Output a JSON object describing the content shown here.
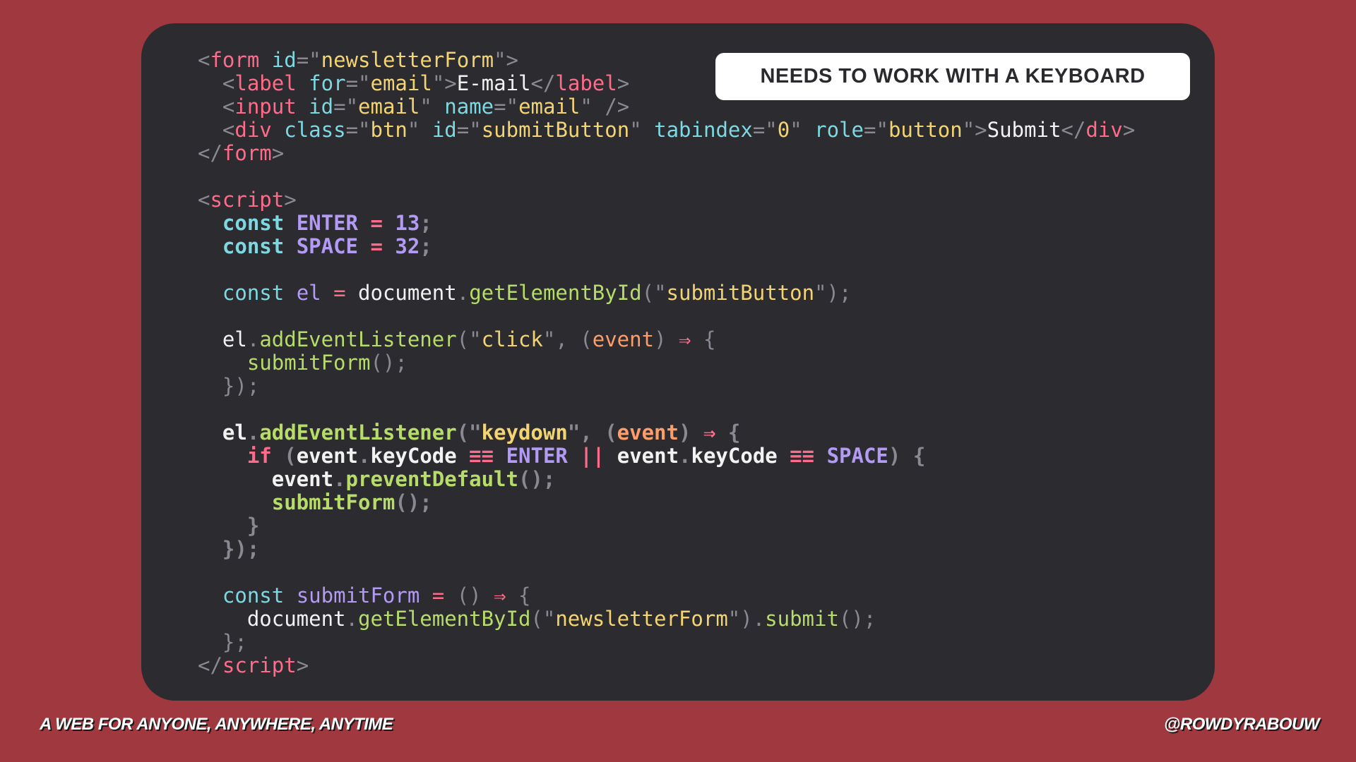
{
  "badge": "NEEDS TO WORK WITH A KEYBOARD",
  "footer": {
    "left": "A WEB FOR ANYONE, ANYWHERE, ANYTIME",
    "right": "@ROWDYRABOUW"
  },
  "colors": {
    "background": "#a03840",
    "card": "#2c2b30",
    "tag": "#ff6b8a",
    "attribute": "#7dd8e2",
    "string": "#f3d472",
    "keyword": "#7dd8e2",
    "variable": "#b39af5",
    "function": "#b8dc6a",
    "parameter": "#fc9d6a"
  },
  "code_lines": [
    {
      "bold": false,
      "tokens": [
        [
          "punct",
          "<"
        ],
        [
          "tag",
          "form"
        ],
        [
          "plain",
          " "
        ],
        [
          "attr",
          "id"
        ],
        [
          "punct",
          "="
        ],
        [
          "punct",
          "\""
        ],
        [
          "str",
          "newsletterForm"
        ],
        [
          "punct",
          "\">"
        ]
      ]
    },
    {
      "bold": false,
      "tokens": [
        [
          "plain",
          "  "
        ],
        [
          "punct",
          "<"
        ],
        [
          "tag",
          "label"
        ],
        [
          "plain",
          " "
        ],
        [
          "attr",
          "for"
        ],
        [
          "punct",
          "="
        ],
        [
          "punct",
          "\""
        ],
        [
          "str",
          "email"
        ],
        [
          "punct",
          "\">"
        ],
        [
          "plain",
          "E-mail"
        ],
        [
          "punct",
          "</"
        ],
        [
          "tag",
          "label"
        ],
        [
          "punct",
          ">"
        ]
      ]
    },
    {
      "bold": false,
      "tokens": [
        [
          "plain",
          "  "
        ],
        [
          "punct",
          "<"
        ],
        [
          "tag",
          "input"
        ],
        [
          "plain",
          " "
        ],
        [
          "attr",
          "id"
        ],
        [
          "punct",
          "="
        ],
        [
          "punct",
          "\""
        ],
        [
          "str",
          "email"
        ],
        [
          "punct",
          "\""
        ],
        [
          "plain",
          " "
        ],
        [
          "attr",
          "name"
        ],
        [
          "punct",
          "="
        ],
        [
          "punct",
          "\""
        ],
        [
          "str",
          "email"
        ],
        [
          "punct",
          "\""
        ],
        [
          "plain",
          " "
        ],
        [
          "punct",
          "/>"
        ]
      ]
    },
    {
      "bold": false,
      "tokens": [
        [
          "plain",
          "  "
        ],
        [
          "punct",
          "<"
        ],
        [
          "tag",
          "div"
        ],
        [
          "plain",
          " "
        ],
        [
          "attr",
          "class"
        ],
        [
          "punct",
          "="
        ],
        [
          "punct",
          "\""
        ],
        [
          "str",
          "btn"
        ],
        [
          "punct",
          "\""
        ],
        [
          "plain",
          " "
        ],
        [
          "attr",
          "id"
        ],
        [
          "punct",
          "="
        ],
        [
          "punct",
          "\""
        ],
        [
          "str",
          "submitButton"
        ],
        [
          "punct",
          "\""
        ],
        [
          "plain",
          " "
        ],
        [
          "attr",
          "tabindex"
        ],
        [
          "punct",
          "="
        ],
        [
          "punct",
          "\""
        ],
        [
          "str",
          "0"
        ],
        [
          "punct",
          "\""
        ],
        [
          "plain",
          " "
        ],
        [
          "attr",
          "role"
        ],
        [
          "punct",
          "="
        ],
        [
          "punct",
          "\""
        ],
        [
          "str",
          "button"
        ],
        [
          "punct",
          "\">"
        ],
        [
          "plain",
          "Submit"
        ],
        [
          "punct",
          "</"
        ],
        [
          "tag",
          "div"
        ],
        [
          "punct",
          ">"
        ]
      ]
    },
    {
      "bold": false,
      "tokens": [
        [
          "punct",
          "</"
        ],
        [
          "tag",
          "form"
        ],
        [
          "punct",
          ">"
        ]
      ]
    },
    {
      "bold": false,
      "tokens": []
    },
    {
      "bold": false,
      "tokens": [
        [
          "punct",
          "<"
        ],
        [
          "tag",
          "script"
        ],
        [
          "punct",
          ">"
        ]
      ]
    },
    {
      "bold": true,
      "tokens": [
        [
          "plain",
          "  "
        ],
        [
          "kw",
          "const"
        ],
        [
          "plain",
          " "
        ],
        [
          "var",
          "ENTER"
        ],
        [
          "plain",
          " "
        ],
        [
          "op",
          "="
        ],
        [
          "plain",
          " "
        ],
        [
          "num",
          "13"
        ],
        [
          "punct",
          ";"
        ]
      ]
    },
    {
      "bold": true,
      "tokens": [
        [
          "plain",
          "  "
        ],
        [
          "kw",
          "const"
        ],
        [
          "plain",
          " "
        ],
        [
          "var",
          "SPACE"
        ],
        [
          "plain",
          " "
        ],
        [
          "op",
          "="
        ],
        [
          "plain",
          " "
        ],
        [
          "num",
          "32"
        ],
        [
          "punct",
          ";"
        ]
      ]
    },
    {
      "bold": false,
      "tokens": []
    },
    {
      "bold": false,
      "tokens": [
        [
          "plain",
          "  "
        ],
        [
          "kw",
          "const"
        ],
        [
          "plain",
          " "
        ],
        [
          "var",
          "el"
        ],
        [
          "plain",
          " "
        ],
        [
          "op",
          "="
        ],
        [
          "plain",
          " "
        ],
        [
          "plain",
          "document"
        ],
        [
          "punct",
          "."
        ],
        [
          "fn",
          "getElementById"
        ],
        [
          "punct",
          "(\""
        ],
        [
          "str",
          "submitButton"
        ],
        [
          "punct",
          "\");"
        ]
      ]
    },
    {
      "bold": false,
      "tokens": []
    },
    {
      "bold": false,
      "tokens": [
        [
          "plain",
          "  el"
        ],
        [
          "punct",
          "."
        ],
        [
          "fn",
          "addEventListener"
        ],
        [
          "punct",
          "(\""
        ],
        [
          "str",
          "click"
        ],
        [
          "punct",
          "\", ("
        ],
        [
          "param",
          "event"
        ],
        [
          "punct",
          ")"
        ],
        [
          "plain",
          " "
        ],
        [
          "op",
          "⇒"
        ],
        [
          "plain",
          " "
        ],
        [
          "punct",
          "{"
        ]
      ]
    },
    {
      "bold": false,
      "tokens": [
        [
          "plain",
          "    "
        ],
        [
          "fn",
          "submitForm"
        ],
        [
          "punct",
          "();"
        ]
      ]
    },
    {
      "bold": false,
      "tokens": [
        [
          "plain",
          "  "
        ],
        [
          "punct",
          "});"
        ]
      ]
    },
    {
      "bold": false,
      "tokens": []
    },
    {
      "bold": true,
      "tokens": [
        [
          "plain",
          "  el"
        ],
        [
          "punct",
          "."
        ],
        [
          "fn",
          "addEventListener"
        ],
        [
          "punct",
          "(\""
        ],
        [
          "str",
          "keydown"
        ],
        [
          "punct",
          "\", ("
        ],
        [
          "param",
          "event"
        ],
        [
          "punct",
          ")"
        ],
        [
          "plain",
          " "
        ],
        [
          "op",
          "⇒"
        ],
        [
          "plain",
          " "
        ],
        [
          "punct",
          "{"
        ]
      ]
    },
    {
      "bold": true,
      "tokens": [
        [
          "plain",
          "    "
        ],
        [
          "if",
          "if"
        ],
        [
          "plain",
          " "
        ],
        [
          "punct",
          "("
        ],
        [
          "plain",
          "event"
        ],
        [
          "punct",
          "."
        ],
        [
          "plain",
          "keyCode"
        ],
        [
          "plain",
          " "
        ],
        [
          "op",
          "≡≡"
        ],
        [
          "plain",
          " "
        ],
        [
          "var",
          "ENTER"
        ],
        [
          "plain",
          " "
        ],
        [
          "op",
          "||"
        ],
        [
          "plain",
          " "
        ],
        [
          "plain",
          "event"
        ],
        [
          "punct",
          "."
        ],
        [
          "plain",
          "keyCode"
        ],
        [
          "plain",
          " "
        ],
        [
          "op",
          "≡≡"
        ],
        [
          "plain",
          " "
        ],
        [
          "var",
          "SPACE"
        ],
        [
          "punct",
          ")"
        ],
        [
          "plain",
          " "
        ],
        [
          "punct",
          "{"
        ]
      ]
    },
    {
      "bold": true,
      "tokens": [
        [
          "plain",
          "      event"
        ],
        [
          "punct",
          "."
        ],
        [
          "fn",
          "preventDefault"
        ],
        [
          "punct",
          "();"
        ]
      ]
    },
    {
      "bold": true,
      "tokens": [
        [
          "plain",
          "      "
        ],
        [
          "fn",
          "submitForm"
        ],
        [
          "punct",
          "();"
        ]
      ]
    },
    {
      "bold": true,
      "tokens": [
        [
          "plain",
          "    "
        ],
        [
          "punct",
          "}"
        ]
      ]
    },
    {
      "bold": true,
      "tokens": [
        [
          "plain",
          "  "
        ],
        [
          "punct",
          "});"
        ]
      ]
    },
    {
      "bold": false,
      "tokens": []
    },
    {
      "bold": false,
      "tokens": [
        [
          "plain",
          "  "
        ],
        [
          "kw",
          "const"
        ],
        [
          "plain",
          " "
        ],
        [
          "var",
          "submitForm"
        ],
        [
          "plain",
          " "
        ],
        [
          "op",
          "="
        ],
        [
          "plain",
          " "
        ],
        [
          "punct",
          "()"
        ],
        [
          "plain",
          " "
        ],
        [
          "op",
          "⇒"
        ],
        [
          "plain",
          " "
        ],
        [
          "punct",
          "{"
        ]
      ]
    },
    {
      "bold": false,
      "tokens": [
        [
          "plain",
          "    document"
        ],
        [
          "punct",
          "."
        ],
        [
          "fn",
          "getElementById"
        ],
        [
          "punct",
          "(\""
        ],
        [
          "str",
          "newsletterForm"
        ],
        [
          "punct",
          "\")."
        ],
        [
          "fn",
          "submit"
        ],
        [
          "punct",
          "();"
        ]
      ]
    },
    {
      "bold": false,
      "tokens": [
        [
          "plain",
          "  "
        ],
        [
          "punct",
          "};"
        ]
      ]
    },
    {
      "bold": false,
      "tokens": [
        [
          "punct",
          "</"
        ],
        [
          "tag",
          "script"
        ],
        [
          "punct",
          ">"
        ]
      ]
    }
  ]
}
